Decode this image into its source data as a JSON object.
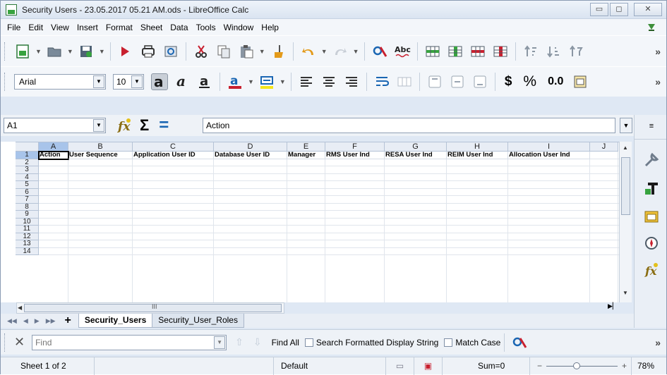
{
  "window": {
    "title": "Security Users - 23.05.2017 05.21 AM.ods - LibreOffice Calc"
  },
  "window_buttons": {
    "minimize": "▭",
    "restore": "◻",
    "close": "✕"
  },
  "menu": {
    "items": [
      "File",
      "Edit",
      "View",
      "Insert",
      "Format",
      "Sheet",
      "Data",
      "Tools",
      "Window",
      "Help"
    ]
  },
  "toolbar_more": "»",
  "format_toolbar": {
    "font": "Arial",
    "size": "10",
    "currency": "$",
    "percent": "%",
    "number": "0.0"
  },
  "formula_bar": {
    "name_box": "A1",
    "sum_symbol": "Σ",
    "equals_symbol": "=",
    "content": "Action"
  },
  "sheet": {
    "columns": [
      "A",
      "B",
      "C",
      "D",
      "E",
      "F",
      "G",
      "H",
      "I",
      "J"
    ],
    "rows": [
      "1",
      "2",
      "3",
      "4",
      "5",
      "6",
      "7",
      "8",
      "9",
      "10",
      "11",
      "12",
      "13",
      "14"
    ],
    "header_cells": [
      "Action",
      "User Sequence",
      "Application User ID",
      "Database User ID",
      "Manager",
      "RMS User Ind",
      "RESA User Ind",
      "REIM User Ind",
      "Allocation User Ind"
    ]
  },
  "hscroll_label": "III",
  "tabs": {
    "items": [
      "Security_Users",
      "Security_User_Roles"
    ],
    "active": "Security_Users"
  },
  "find_toolbar": {
    "placeholder": "Find",
    "find_all": "Find All",
    "search_formatted": "Search Formatted Display String",
    "match_case": "Match Case"
  },
  "status": {
    "sheet": "Sheet 1 of 2",
    "page_style": "Default",
    "sum": "Sum=0",
    "zoom": "78%",
    "zoom_out": "−",
    "zoom_in": "+"
  }
}
